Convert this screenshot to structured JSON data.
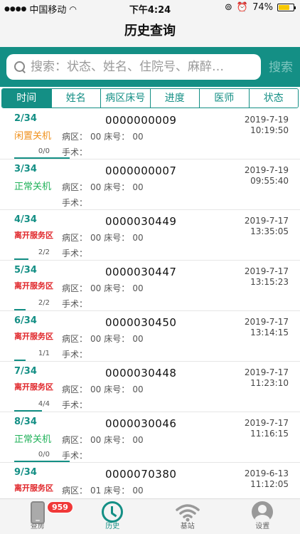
{
  "statusbar": {
    "carrier": "中国移动",
    "time": "下午4:24",
    "battery": "74%",
    "battery_level": 0.74
  },
  "nav": {
    "title": "历史查询"
  },
  "search": {
    "placeholder": "搜索：状态、姓名、住院号、麻醉…",
    "button": "搜索"
  },
  "tabs": [
    {
      "label": "时间",
      "active": true
    },
    {
      "label": "姓名"
    },
    {
      "label": "病区床号"
    },
    {
      "label": "进度"
    },
    {
      "label": "医师"
    },
    {
      "label": "状态"
    }
  ],
  "rows": [
    {
      "index": "2/34",
      "status": "闲置关机",
      "status_type": "idle",
      "id": "0000000009",
      "date": "2019-7-19",
      "time": "10:19:50",
      "area_label": "病区：",
      "area": "00",
      "bed_label": "床号：",
      "bed": "00",
      "count": "0/0",
      "surgery_label": "手术：",
      "progress": 1.0
    },
    {
      "index": "3/34",
      "status": "正常关机",
      "status_type": "normal",
      "id": "0000000007",
      "date": "2019-7-19",
      "time": "09:55:40",
      "area_label": "病区：",
      "area": "00",
      "bed_label": "床号：",
      "bed": "00",
      "count": "",
      "surgery_label": "手术：",
      "progress": 0.0
    },
    {
      "index": "4/34",
      "status": "离开服务区",
      "status_type": "leave",
      "id": "0000030449",
      "date": "2019-7-17",
      "time": "13:35:05",
      "area_label": "病区：",
      "area": "00",
      "bed_label": "床号：",
      "bed": "00",
      "count": "2/2",
      "surgery_label": "手术：",
      "progress": 0.25
    },
    {
      "index": "5/34",
      "status": "离开服务区",
      "status_type": "leave",
      "id": "0000030447",
      "date": "2019-7-17",
      "time": "13:15:23",
      "area_label": "病区：",
      "area": "00",
      "bed_label": "床号：",
      "bed": "00",
      "count": "2/2",
      "surgery_label": "手术：",
      "progress": 0.2
    },
    {
      "index": "6/34",
      "status": "离开服务区",
      "status_type": "leave",
      "id": "0000030450",
      "date": "2019-7-17",
      "time": "13:14:15",
      "area_label": "病区：",
      "area": "00",
      "bed_label": "床号：",
      "bed": "00",
      "count": "1/1",
      "surgery_label": "手术：",
      "progress": 0.2
    },
    {
      "index": "7/34",
      "status": "离开服务区",
      "status_type": "leave",
      "id": "0000030448",
      "date": "2019-7-17",
      "time": "11:23:10",
      "area_label": "病区：",
      "area": "00",
      "bed_label": "床号：",
      "bed": "00",
      "count": "4/4",
      "surgery_label": "手术：",
      "progress": 0.5
    },
    {
      "index": "8/34",
      "status": "正常关机",
      "status_type": "normal",
      "id": "0000030046",
      "date": "2019-7-17",
      "time": "11:16:15",
      "area_label": "病区：",
      "area": "00",
      "bed_label": "床号：",
      "bed": "00",
      "count": "0/0",
      "surgery_label": "手术：",
      "progress": 1.0
    },
    {
      "index": "9/34",
      "status": "离开服务区",
      "status_type": "leave",
      "id": "0000070380",
      "date": "2019-6-13",
      "time": "11:12:05",
      "area_label": "病区：",
      "area": "01",
      "bed_label": "床号：",
      "bed": "00",
      "count": "",
      "surgery_label": "",
      "progress": 0.0
    }
  ],
  "tabbar": [
    {
      "label": "查房",
      "icon": "phone-icon",
      "badge": "959"
    },
    {
      "label": "历史",
      "icon": "clock-icon",
      "active": true
    },
    {
      "label": "基站",
      "icon": "wifi-icon"
    },
    {
      "label": "设置",
      "icon": "user-icon"
    }
  ],
  "colors": {
    "accent": "#148f85",
    "idle": "#f0921f",
    "normal": "#21b25a",
    "leave": "#e0262a"
  }
}
